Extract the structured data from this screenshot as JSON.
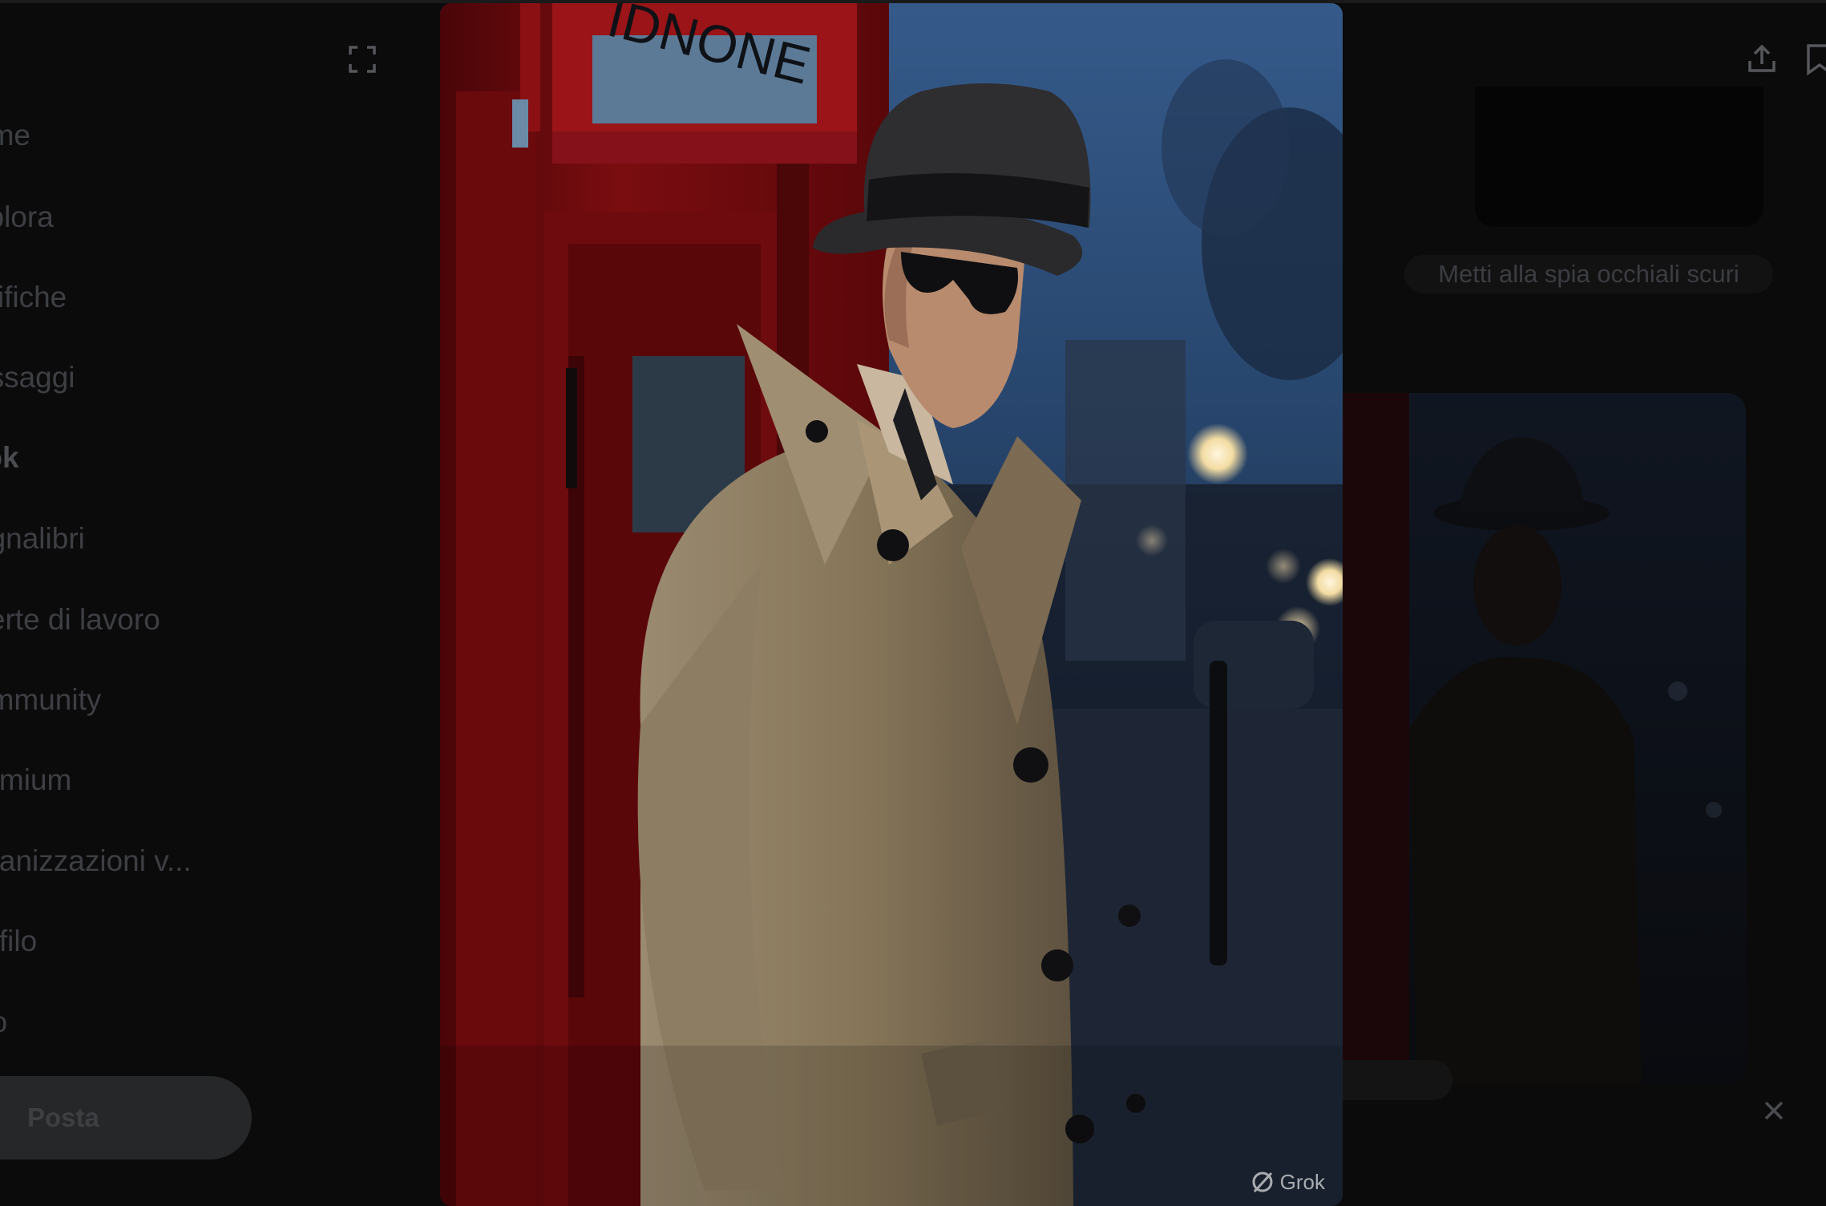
{
  "sidebar": {
    "items": [
      {
        "label": "ome"
      },
      {
        "label": "splora"
      },
      {
        "label": "otifiche"
      },
      {
        "label": "essaggi"
      },
      {
        "label": "rok"
      },
      {
        "label": "egnalibri"
      },
      {
        "label": "fferte di lavoro"
      },
      {
        "label": "ommunity"
      },
      {
        "label": "remium"
      },
      {
        "label": "rganizzazioni v..."
      },
      {
        "label": "rofilo"
      },
      {
        "label": "tro"
      }
    ],
    "active_index": 4,
    "post_label": "Posta"
  },
  "viewer": {
    "expand_icon": "expand-icon",
    "share_icon": "share-icon",
    "bookmark_icon": "bookmark-icon",
    "close_icon": "close-icon",
    "watermark": "Grok",
    "phone_box_sign": "IDNONE"
  },
  "right_column": {
    "caption": "Metti alla spia occhiali scuri"
  },
  "colors": {
    "background": "#0b0b0c",
    "phone_box_red": "#7a0d10",
    "coat": "#8a7a60",
    "sky": "#3d5f8f"
  }
}
